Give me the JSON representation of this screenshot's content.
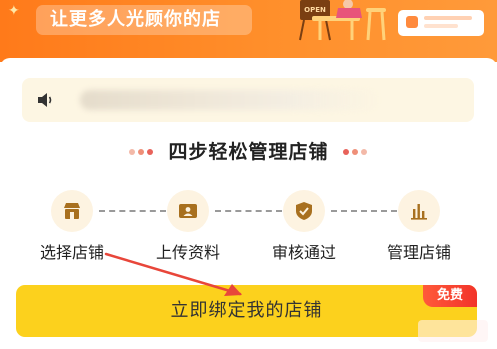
{
  "banner": {
    "slogan": "让更多人光顾你的店",
    "sign_text": "OPEN"
  },
  "notice": {
    "icon": "speaker-icon"
  },
  "section": {
    "title": "四步轻松管理店铺"
  },
  "steps": [
    {
      "label": "选择店铺",
      "icon": "store-icon"
    },
    {
      "label": "上传资料",
      "icon": "id-card-icon"
    },
    {
      "label": "审核通过",
      "icon": "shield-check-icon"
    },
    {
      "label": "管理店铺",
      "icon": "bar-chart-icon"
    }
  ],
  "cta": {
    "label": "立即绑定我的店铺",
    "badge": "免费"
  },
  "colors": {
    "banner_orange": "#ff8a25",
    "cta_yellow": "#fcd11d",
    "badge_red": "#f2332a",
    "icon_brown": "#a8701f",
    "arrow_red": "#e8463a"
  }
}
